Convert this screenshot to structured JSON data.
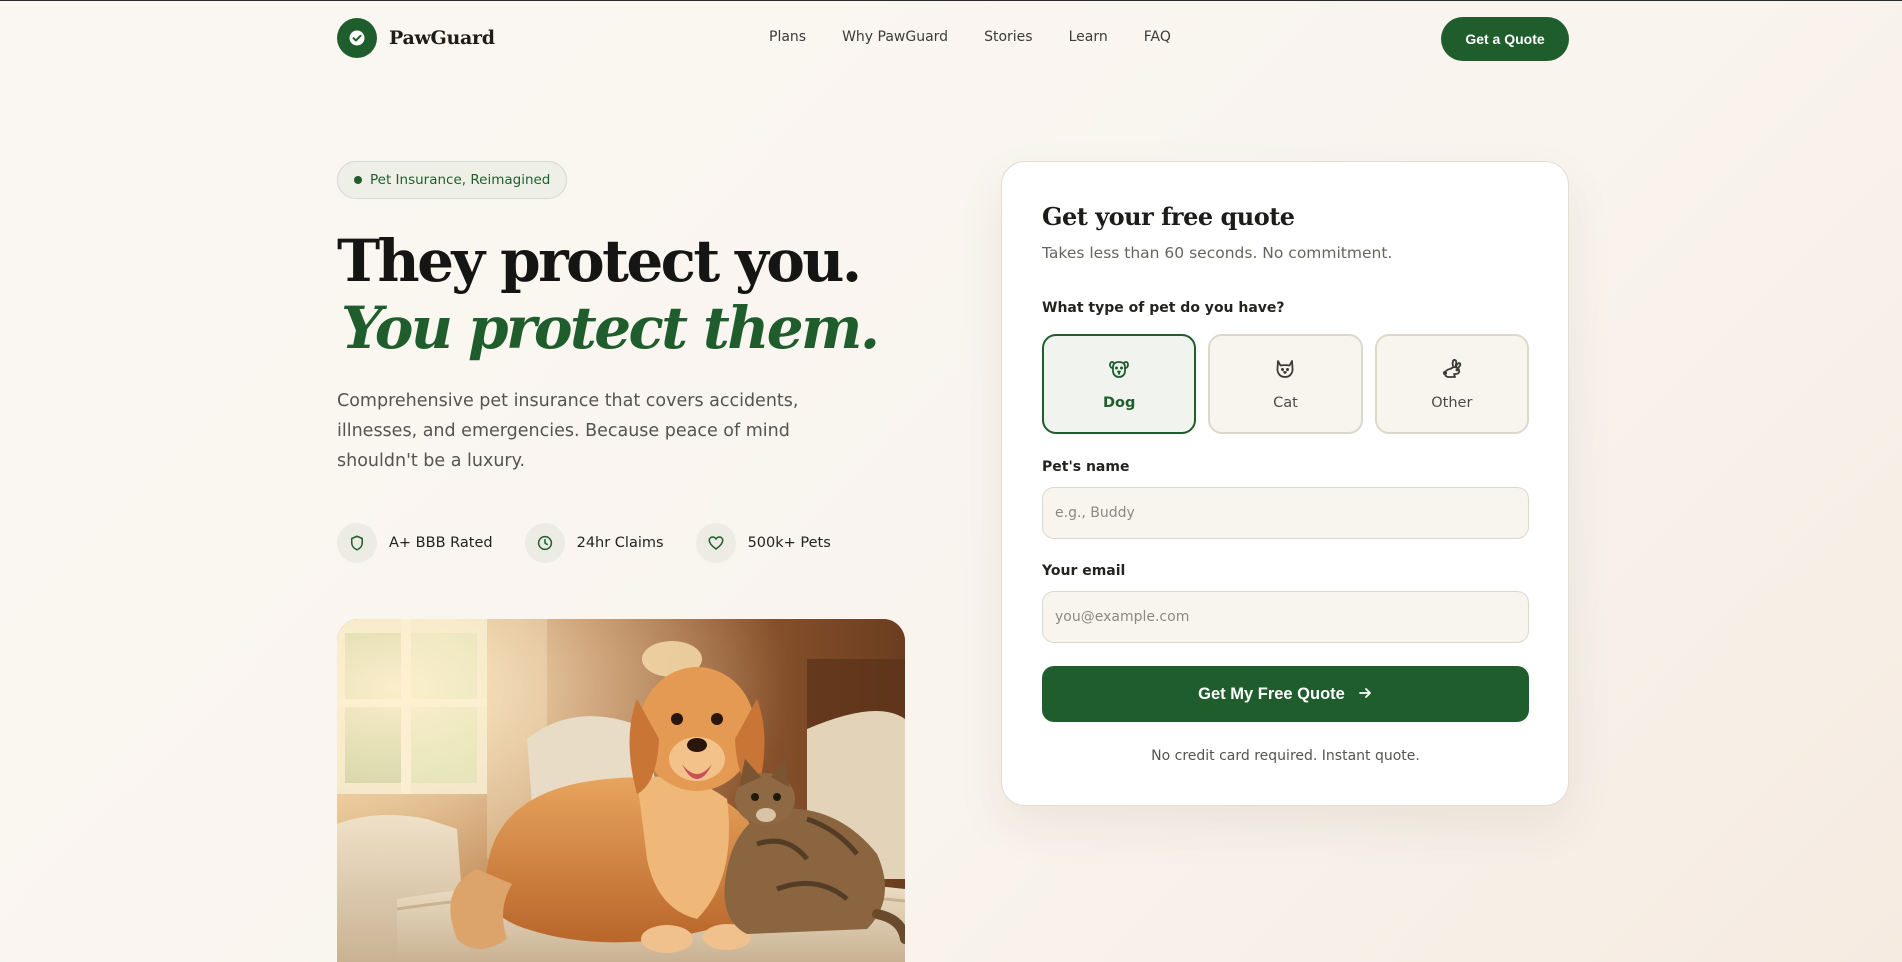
{
  "brand": {
    "name": "PawGuard",
    "logo_icon": "check-icon"
  },
  "nav": {
    "links": [
      "Plans",
      "Why PawGuard",
      "Stories",
      "Learn",
      "FAQ"
    ],
    "cta_label": "Get a Quote"
  },
  "hero": {
    "pill_text": "Pet Insurance, Reimagined",
    "headline_line1": "They protect you.",
    "headline_line2": "You protect them.",
    "lead": "Comprehensive pet insurance that covers accidents, illnesses, and emergencies. Because peace of mind shouldn't be a luxury.",
    "badges": [
      {
        "icon": "shield-icon",
        "label": "A+ BBB Rated"
      },
      {
        "icon": "clock-icon",
        "label": "24hr Claims"
      },
      {
        "icon": "heart-icon",
        "label": "500k+ Pets"
      }
    ]
  },
  "quote_form": {
    "title": "Get your free quote",
    "subtitle": "Takes less than 60 seconds. No commitment.",
    "pet_question": "What type of pet do you have?",
    "pet_options": [
      {
        "label": "Dog",
        "icon": "dog-icon",
        "selected": true
      },
      {
        "label": "Cat",
        "icon": "cat-icon",
        "selected": false
      },
      {
        "label": "Other",
        "icon": "rabbit-icon",
        "selected": false
      }
    ],
    "pet_name_label": "Pet's name",
    "pet_name_placeholder": "e.g., Buddy",
    "pet_name_value": "",
    "email_label": "Your email",
    "email_placeholder": "you@example.com",
    "email_value": "",
    "submit_label": "Get My Free Quote",
    "submit_icon": "arrow-right-icon",
    "fine_print": "No credit card required. Instant quote."
  },
  "colors": {
    "brand_green": "#1f5e2c",
    "background": "#faf7f2",
    "card": "#ffffff",
    "text_dark": "#1c1c1a",
    "text_muted": "#55554f"
  }
}
